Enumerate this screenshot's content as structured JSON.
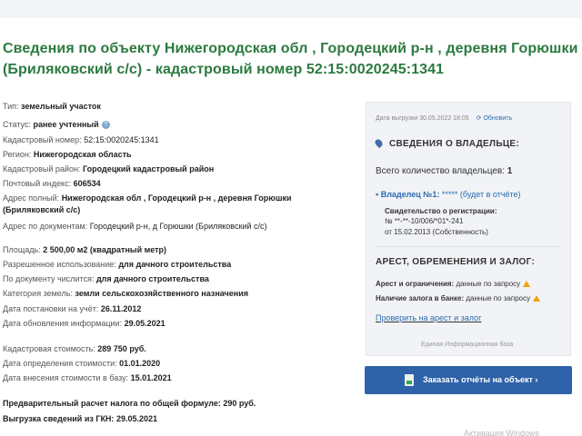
{
  "page": {
    "title": "Сведения по объекту Нижегородская обл , Городецкий р-н , деревня Горюшки (Бриляковский с/с) - кадастровый номер 52:15:0020245:1341"
  },
  "details": {
    "type_label": "Тип:",
    "type_value": "земельный участок",
    "status_label": "Статус:",
    "status_value": "ранее учтенный",
    "cadnum_label": "Кадастровый номер:",
    "cadnum_value": "52:15:0020245:1341",
    "region_label": "Регион:",
    "region_value": "Нижегородская область",
    "district_label": "Кадастровый район:",
    "district_value": "Городецкий кадастровый район",
    "postal_label": "Почтовый индекс:",
    "postal_value": "606534",
    "address_label": "Адрес полный:",
    "address_value_1": "Нижегородская обл , Городецкий р-н , деревня Горюшки",
    "address_value_2": "(Бриляковский с/с)",
    "docaddress_label": "Адрес по документам:",
    "docaddress_value": "Городецкий р-н, д Горюшки (Бриляковский с/с)",
    "area_label": "Площадь:",
    "area_value": "2 500,00 м2 (квадратный метр)",
    "allowed_use_label": "Разрешенное использование:",
    "allowed_use_value": "для дачного строительства",
    "doc_use_label": "По документу числится:",
    "doc_use_value": "для дачного строительства",
    "land_cat_label": "Категория земель:",
    "land_cat_value": "земли сельскохозяйственного назначения",
    "reg_date_label": "Дата постановки на учёт:",
    "reg_date_value": "26.11.2012",
    "upd_date_label": "Дата обновления информации:",
    "upd_date_value": "29.05.2021",
    "cad_cost_label": "Кадастровая стоимость:",
    "cad_cost_value": "289 750 руб.",
    "cost_date_label": "Дата определения стоимости:",
    "cost_date_value": "01.01.2020",
    "cost_entry_label": "Дата внесения стоимости в базу:",
    "cost_entry_value": "15.01.2021",
    "tax_label": "Предварительный расчет налога по общей формуле:",
    "tax_value": "290 руб.",
    "gkn_label": "Выгрузка сведений из ГКН:",
    "gkn_value": "29.05.2021"
  },
  "panel": {
    "export_date": "Дата выгрузки 30.05.2022 18:05",
    "refresh_label": "Обновить",
    "owner_heading": "СВЕДЕНИЯ О ВЛАДЕЛЬЦЕ:",
    "owners_count_label": "Всего количество владельцев:",
    "owners_count_value": "1",
    "owner1_label": "Владелец №1:",
    "owner1_value": "*****",
    "owner1_link": "(будет в отчёте)",
    "reg_cert_label": "Свидетельство о регистрации:",
    "reg_cert_number": "№ **-**-10/006/*01*-241",
    "reg_cert_date": "от 15.02.2013 (Собственность)",
    "arrest_heading": "АРЕСТ, ОБРЕМЕНЕНИЯ И ЗАЛОГ:",
    "arrest_label": "Арест и ограничения:",
    "arrest_value": "данные по запросу",
    "pledge_label": "Наличие залога в банке:",
    "pledge_value": "данные по запросу",
    "check_link": "Проверить на арест и залог",
    "footer_note": "Единая Информационная база"
  },
  "cta": {
    "label": "Заказать отчёты на объект ›"
  },
  "watermark": {
    "text": "Активация Windows"
  },
  "colors": {
    "title": "#2b7a3f",
    "link": "#2b6cb0",
    "cta": "#2f62a8",
    "warning": "#f0a30a"
  }
}
